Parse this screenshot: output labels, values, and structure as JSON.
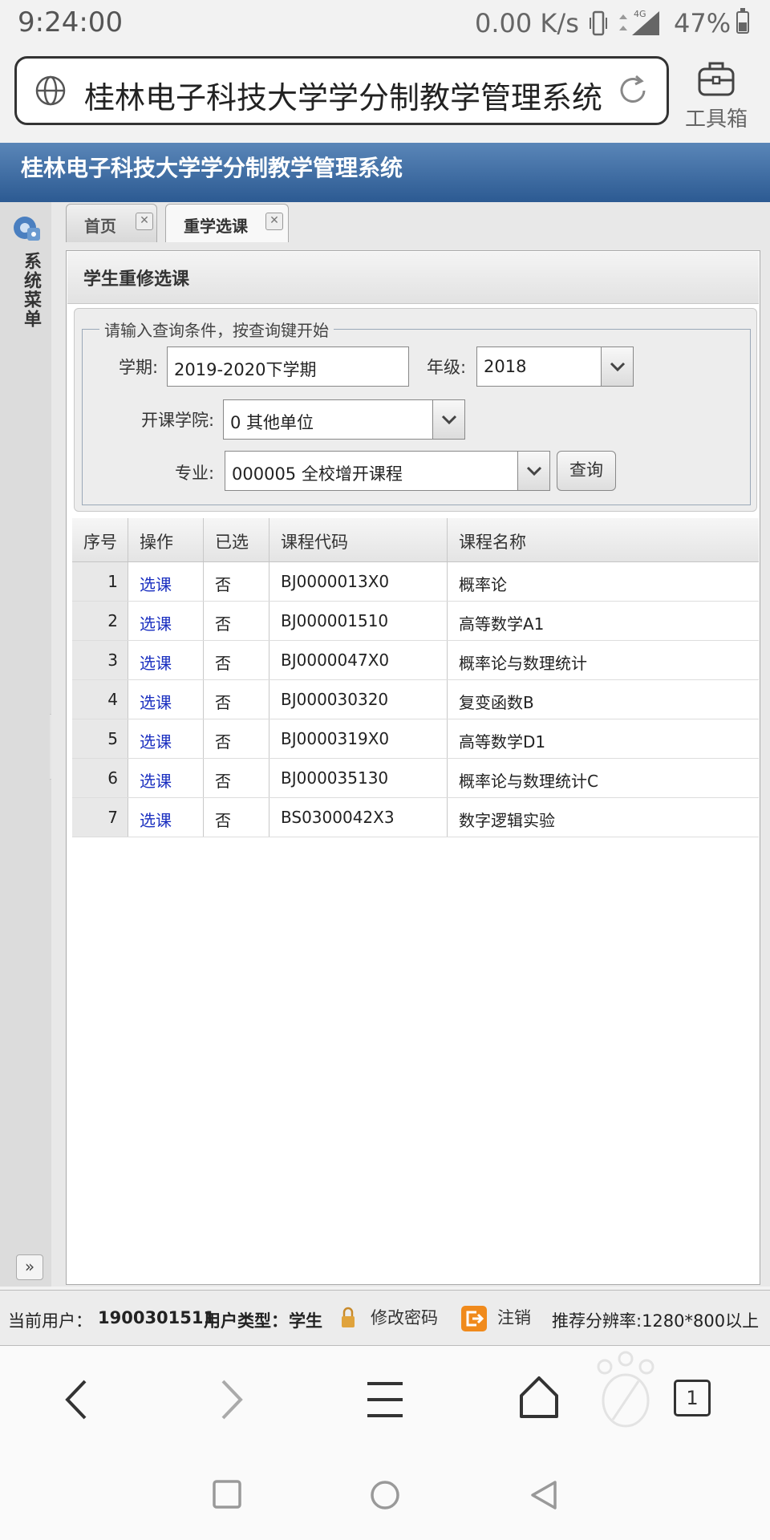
{
  "status_bar": {
    "time": "9:24:00",
    "speed": "0.00 K/s",
    "network": "4G",
    "battery": "47%",
    "battery_level": 0.47
  },
  "browser": {
    "address_text": "桂林电子科技大学学分制教学管理系统",
    "toolbox_label": "工具箱",
    "tab_count": "1"
  },
  "app": {
    "header_title": "桂林电子科技大学学分制教学管理系统",
    "left_menu_label": "系统菜单",
    "tabs": [
      {
        "label": "首页"
      },
      {
        "label": "重学选课"
      }
    ],
    "panel_title": "学生重修选课",
    "form": {
      "legend": "请输入查询条件，按查询键开始",
      "term_label": "学期:",
      "term_value": "2019-2020下学期",
      "grade_label": "年级:",
      "grade_value": "2018",
      "college_label": "开课学院:",
      "college_value": "0 其他单位",
      "major_label": "专业:",
      "major_value": "000005 全校增开课程",
      "query_button": "查询"
    },
    "table": {
      "headers": [
        "序号",
        "操作",
        "已选",
        "课程代码",
        "课程名称"
      ],
      "rows": [
        {
          "no": "1",
          "action": "选课",
          "selected": "否",
          "code": "BJ0000013X0",
          "name": "概率论"
        },
        {
          "no": "2",
          "action": "选课",
          "selected": "否",
          "code": "BJ000001510",
          "name": "高等数学A1"
        },
        {
          "no": "3",
          "action": "选课",
          "selected": "否",
          "code": "BJ0000047X0",
          "name": "概率论与数理统计"
        },
        {
          "no": "4",
          "action": "选课",
          "selected": "否",
          "code": "BJ000030320",
          "name": "复变函数B"
        },
        {
          "no": "5",
          "action": "选课",
          "selected": "否",
          "code": "BJ0000319X0",
          "name": "高等数学D1"
        },
        {
          "no": "6",
          "action": "选课",
          "selected": "否",
          "code": "BJ000035130",
          "name": "概率论与数理统计C"
        },
        {
          "no": "7",
          "action": "选课",
          "selected": "否",
          "code": "BS0300042X3",
          "name": "数字逻辑实验"
        }
      ]
    },
    "footer": {
      "current_user_label": "当前用户：",
      "current_user": "1900301511",
      "user_type_label": "用户类型：",
      "user_type": "学生",
      "change_password": "修改密码",
      "logout": "注销",
      "resolution_note": "推荐分辨率:1280*800以上"
    }
  },
  "colors": {
    "header_blue": "#2c5a92",
    "link_blue": "#1a2fc0",
    "logout_orange": "#f08a1c"
  }
}
